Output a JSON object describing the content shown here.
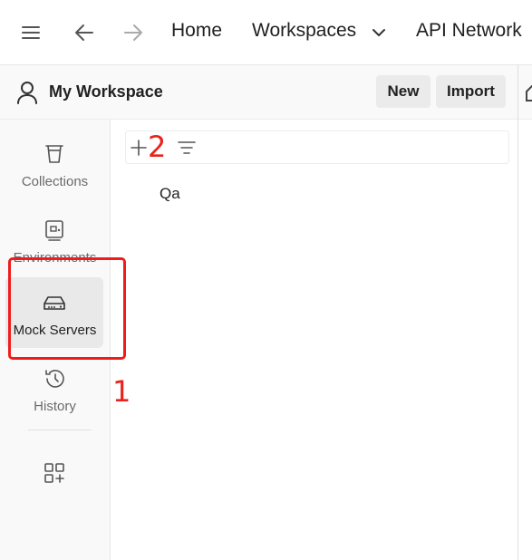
{
  "nav": {
    "home_label": "Home",
    "workspaces_label": "Workspaces",
    "api_network_label": "API Network"
  },
  "workspace": {
    "title": "My Workspace",
    "new_label": "New",
    "import_label": "Import"
  },
  "sidebar": {
    "items": [
      {
        "label": "Collections",
        "icon": "trash-bin-icon"
      },
      {
        "label": "Environments",
        "icon": "environment-icon"
      },
      {
        "label": "Mock Servers",
        "icon": "server-icon",
        "active": true
      },
      {
        "label": "History",
        "icon": "history-icon"
      }
    ],
    "more_icon": "apps-add-icon"
  },
  "main": {
    "list": [
      "Qa"
    ]
  },
  "annotations": {
    "label_1": "1",
    "label_2": "2",
    "color": "#f01c1c"
  }
}
